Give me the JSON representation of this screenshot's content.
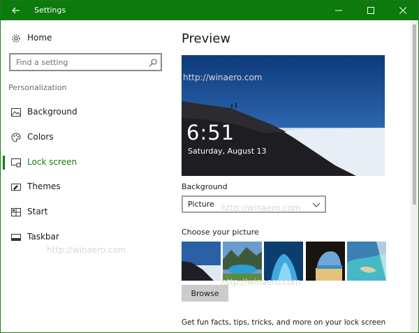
{
  "window": {
    "title": "Settings",
    "accent_color": "#0c7a0c",
    "controls": [
      "back-arrow-icon",
      "minimize-icon",
      "maximize-icon",
      "close-icon"
    ]
  },
  "sidebar": {
    "home_label": "Home",
    "search_placeholder": "Find a setting",
    "section_label": "Personalization",
    "items": [
      {
        "label": "Background",
        "icon": "picture-icon",
        "active": false
      },
      {
        "label": "Colors",
        "icon": "palette-icon",
        "active": false
      },
      {
        "label": "Lock screen",
        "icon": "lock-screen-icon",
        "active": true
      },
      {
        "label": "Themes",
        "icon": "brush-icon",
        "active": false
      },
      {
        "label": "Start",
        "icon": "start-grid-icon",
        "active": false
      },
      {
        "label": "Taskbar",
        "icon": "taskbar-icon",
        "active": false
      }
    ]
  },
  "main": {
    "title": "Preview",
    "preview": {
      "time": "6:51",
      "date": "Saturday, August 13"
    },
    "background_label": "Background",
    "background_value": "Picture",
    "choose_label": "Choose your picture",
    "thumbnails": [
      "mountain-clouds",
      "lake-mountains",
      "ice-cave",
      "beach-cave",
      "aerial-coast"
    ],
    "browse_label": "Browse",
    "footer_text": "Get fun facts, tips, tricks, and more on your lock screen"
  },
  "watermark_text": "http://winaero.com"
}
